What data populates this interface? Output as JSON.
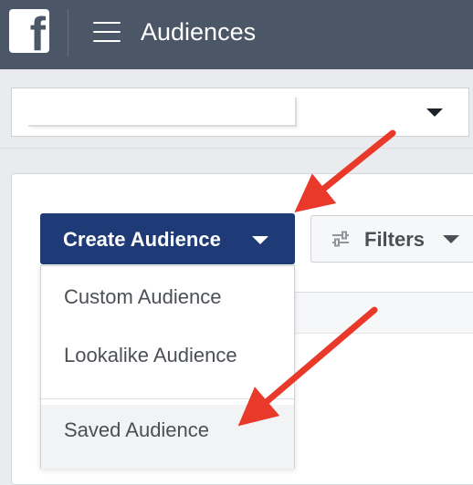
{
  "header": {
    "logo_letter": "f",
    "title": "Audiences"
  },
  "account": {
    "selected": ""
  },
  "toolbar": {
    "create_label": "Create Audience",
    "filters_label": "Filters"
  },
  "dropdown": {
    "items": [
      {
        "label": "Custom Audience"
      },
      {
        "label": "Lookalike Audience"
      },
      {
        "label": "Saved Audience"
      }
    ]
  },
  "colors": {
    "topbar": "#4b5667",
    "primary_button": "#1e3b77",
    "annotation_arrow": "#e8392a"
  },
  "icons": {
    "logo": "facebook-logo-icon",
    "menu": "hamburger-menu-icon",
    "filters": "sliders-icon",
    "caret": "caret-down-icon"
  }
}
